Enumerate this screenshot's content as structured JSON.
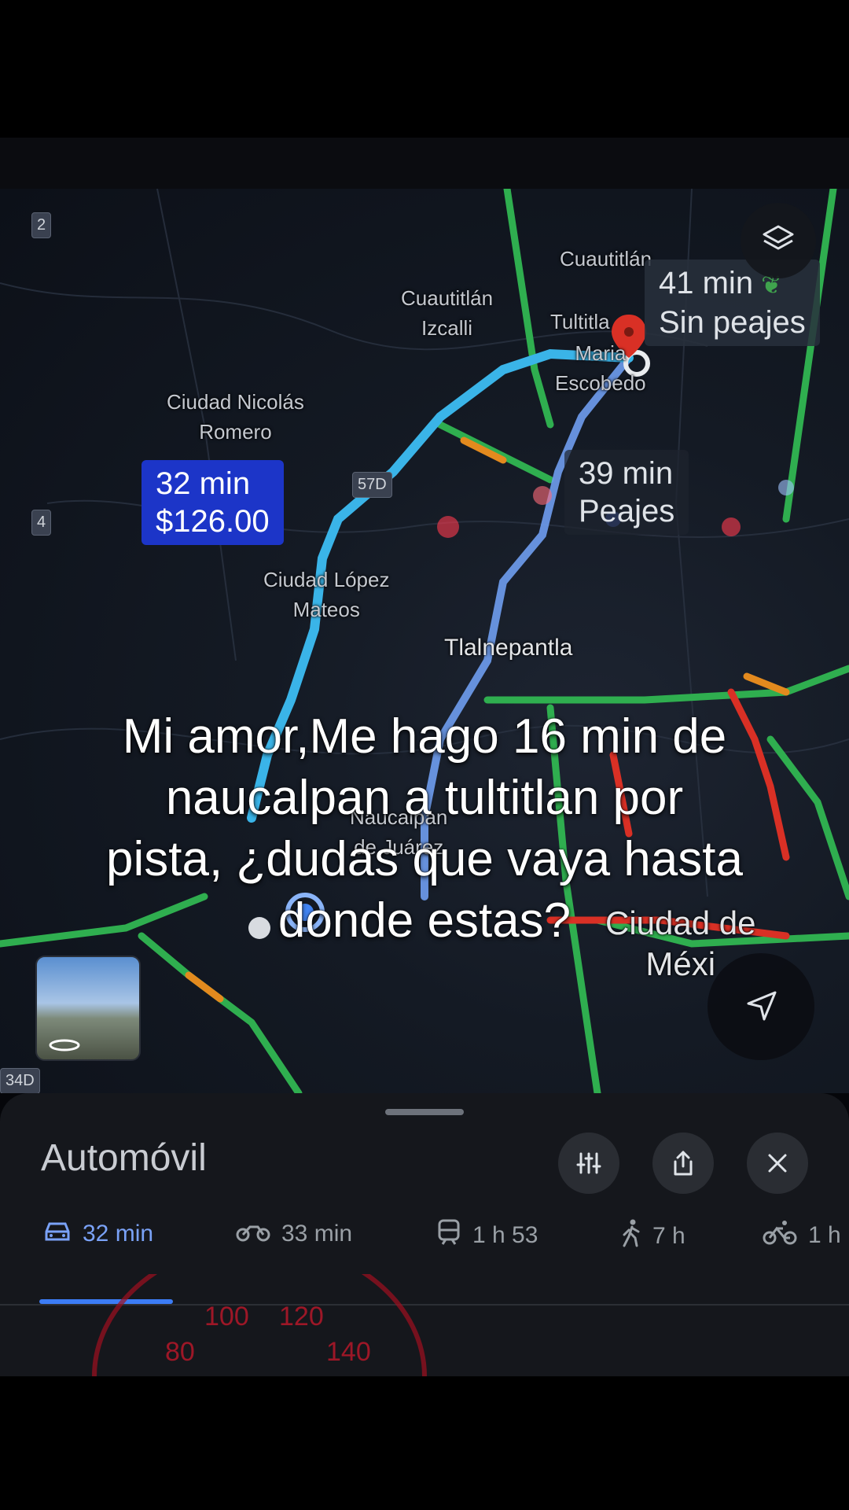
{
  "map": {
    "labels": {
      "cuautitlan": "Cuautitlán",
      "cuautitlan_izcalli_1": "Cuautitlán",
      "cuautitlan_izcalli_2": "Izcalli",
      "tultitlan": "Tultitla",
      "mariano_1": "Maria",
      "mariano_2": "Escobedo",
      "nicolas_1": "Ciudad Nicolás",
      "nicolas_2": "Romero",
      "lopez_1": "Ciudad López",
      "lopez_2": "Mateos",
      "tlalnepantla": "Tlalnepantla",
      "naucalpan_1": "Naucalpan",
      "naucalpan_2": "de Juárez",
      "cdmx_1": "Ciudad de",
      "cdmx_2": "Méxi"
    },
    "shields": {
      "s2": "2",
      "s4": "4",
      "s57d": "57D",
      "s34d": "34D"
    },
    "routes": {
      "main": {
        "time": "32 min",
        "cost": "$126.00"
      },
      "alt_free": {
        "time": "41 min",
        "note": "Sin peajes"
      },
      "alt_toll": {
        "time": "39 min",
        "note": "Peajes"
      }
    },
    "colors": {
      "route_main": "#3ab4e8",
      "route_alt": "#6f9df0",
      "traffic_green": "#2fae4f",
      "traffic_orange": "#e38a1e",
      "traffic_red": "#d93025"
    }
  },
  "caption": {
    "line1": "Mi amor,Me hago 16 min de",
    "line2": "naucalpan a tultitlan por",
    "line3": "pista, ¿dudas que vaya hasta",
    "line4": "donde estas?"
  },
  "sheet": {
    "title": "Automóvil",
    "modes": [
      {
        "icon": "car-icon",
        "label": "32 min"
      },
      {
        "icon": "motorcycle-icon",
        "label": "33 min"
      },
      {
        "icon": "train-icon",
        "label": "1 h 53"
      },
      {
        "icon": "walk-icon",
        "label": "7 h"
      },
      {
        "icon": "bike-icon",
        "label": "1 h"
      }
    ],
    "active_mode": "car"
  },
  "speedometer": {
    "ticks": [
      "80",
      "100",
      "120",
      "140"
    ]
  }
}
